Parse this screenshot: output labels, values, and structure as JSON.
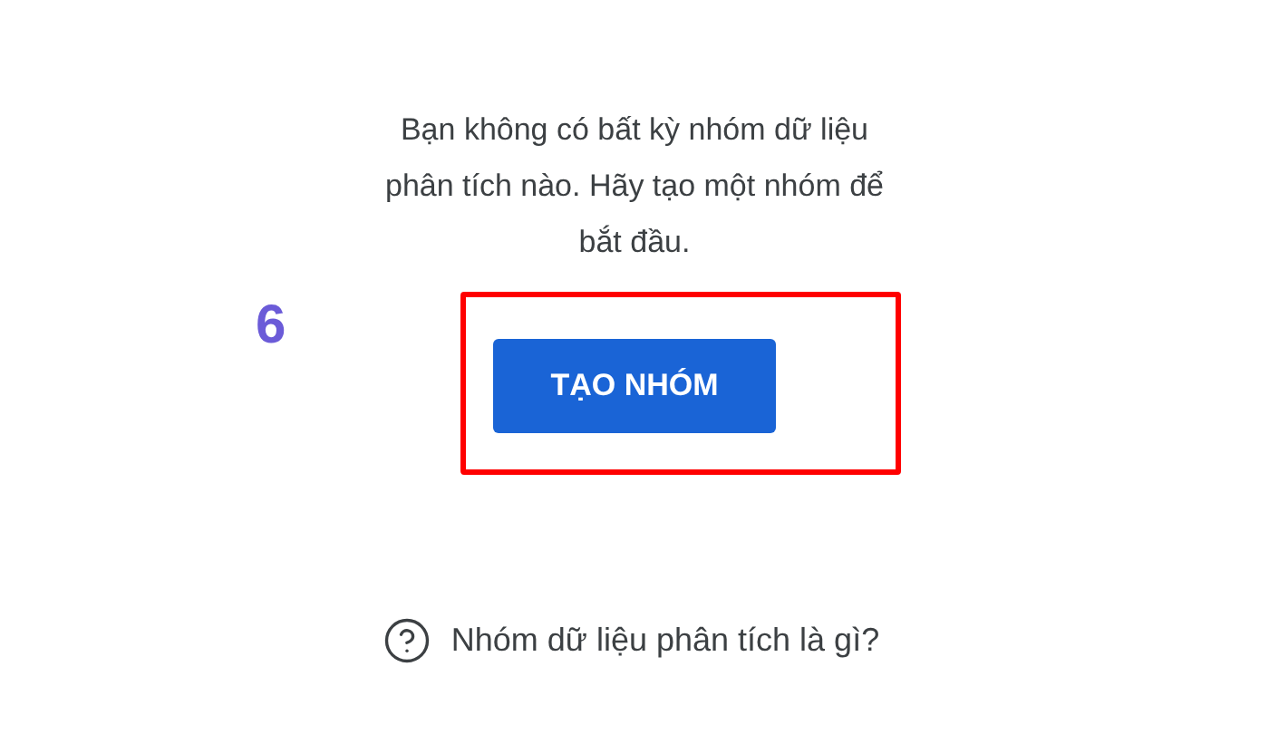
{
  "message": "Bạn không có bất kỳ nhóm dữ liệu phân tích nào. Hãy tạo một nhóm để bắt đầu.",
  "step_number": "6",
  "create_button": {
    "label": "TẠO NHÓM",
    "highlighted": true
  },
  "help_link": {
    "label": "Nhóm dữ liệu phân tích là gì?"
  }
}
